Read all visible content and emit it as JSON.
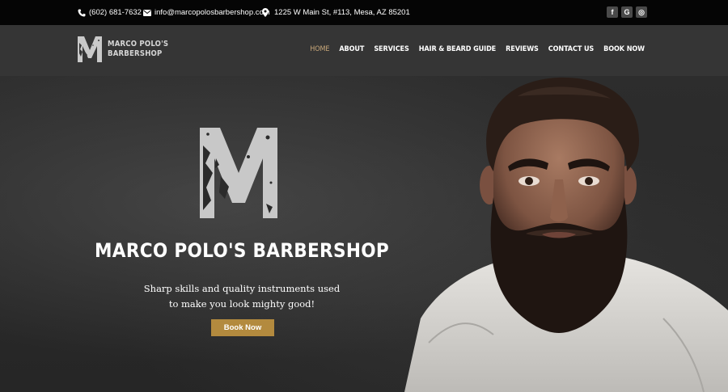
{
  "topbar": {
    "phone": "(602) 681-7632",
    "email": "info@marcopolosbarbershop.com",
    "address": "1225 W Main St, #113, Mesa, AZ 85201",
    "socials": [
      {
        "icon": "facebook-icon",
        "glyph": "f"
      },
      {
        "icon": "google-icon",
        "glyph": "G"
      },
      {
        "icon": "instagram-icon",
        "glyph": "◎"
      }
    ]
  },
  "header": {
    "logo_line1": "MARCO POLO'S",
    "logo_line2": "BARBERSHOP",
    "nav": [
      {
        "label": "HOME",
        "active": true
      },
      {
        "label": "ABOUT",
        "active": false
      },
      {
        "label": "SERVICES",
        "active": false
      },
      {
        "label": "HAIR & BEARD GUIDE",
        "active": false
      },
      {
        "label": "REVIEWS",
        "active": false
      },
      {
        "label": "CONTACT US",
        "active": false
      },
      {
        "label": "BOOK NOW",
        "active": false
      }
    ]
  },
  "hero": {
    "title": "MARCO POLO'S BARBERSHOP",
    "subtitle_line1": "Sharp skills and quality instruments used",
    "subtitle_line2": "to make you look mighty good!",
    "cta_label": "Book Now"
  },
  "colors": {
    "accent": "#b38a3e",
    "nav_active": "#c9a87a",
    "topbar_bg": "#050505",
    "header_bg": "#353535"
  }
}
